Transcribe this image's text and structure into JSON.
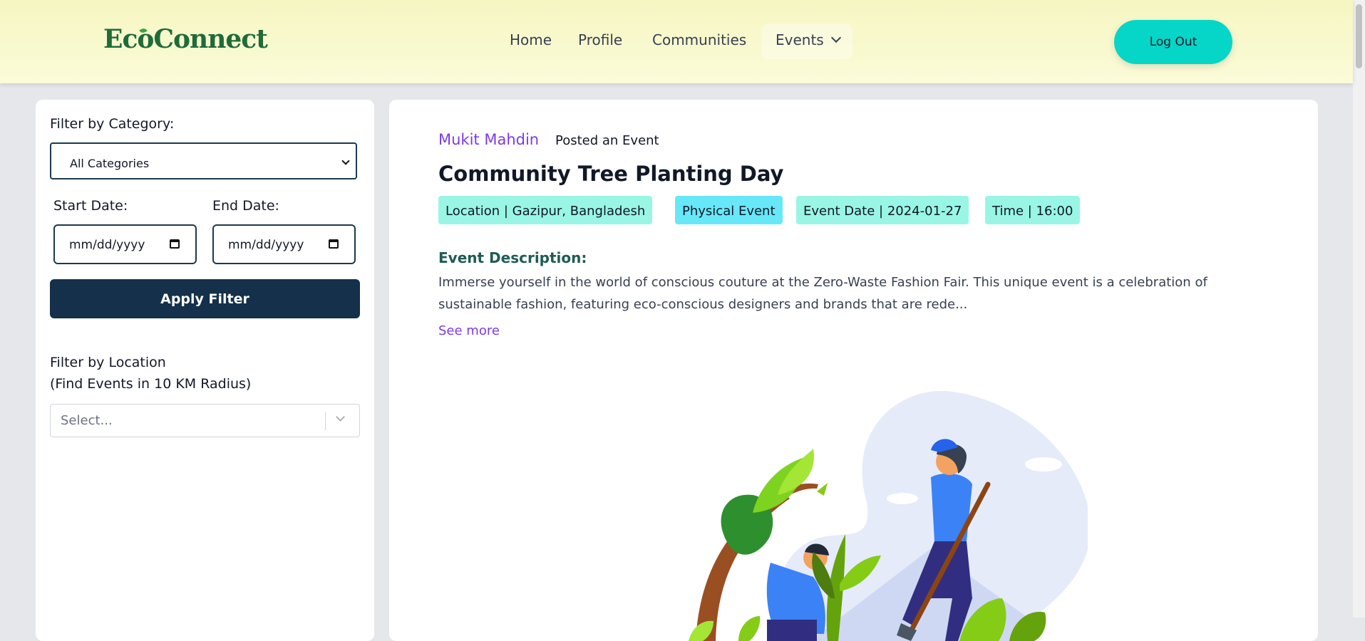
{
  "header": {
    "logo": "EcoConnect",
    "nav": [
      "Home",
      "Profile",
      "Communities",
      "Events"
    ],
    "logout_label": "Log Out"
  },
  "sidebar": {
    "category_label": "Filter by Category:",
    "category_value": "All Categories",
    "start_date_label": "Start Date:",
    "end_date_label": "End Date:",
    "date_placeholder": "mm/dd/yyyy",
    "apply_label": "Apply Filter",
    "location_label_line1": "Filter by Location",
    "location_label_line2": "(Find Events in 10 KM Radius)",
    "location_placeholder": "Select..."
  },
  "event": {
    "author": "Mukit Mahdin",
    "posted_text": "Posted an Event",
    "title": "Community Tree Planting Day",
    "tags": [
      "Location | Gazipur, Bangladesh",
      "Physical Event",
      "Event Date | 2024-01-27",
      "Time | 16:00"
    ],
    "description_heading": "Event Description:",
    "description": "Immerse yourself in the world of conscious couture at the Zero-Waste Fashion Fair. This unique event is a celebration of sustainable fashion, featuring eco-conscious designers and brands that are rede...",
    "see_more": "See more"
  },
  "colors": {
    "header_bg": "#f6f6c2",
    "logout_bg": "#06d6c7",
    "apply_bg": "#14304a",
    "author": "#7c3aed",
    "tag_teal": "#99f6e4",
    "tag_cyan": "#67e8f9",
    "desc_heading": "#1f5c55"
  }
}
